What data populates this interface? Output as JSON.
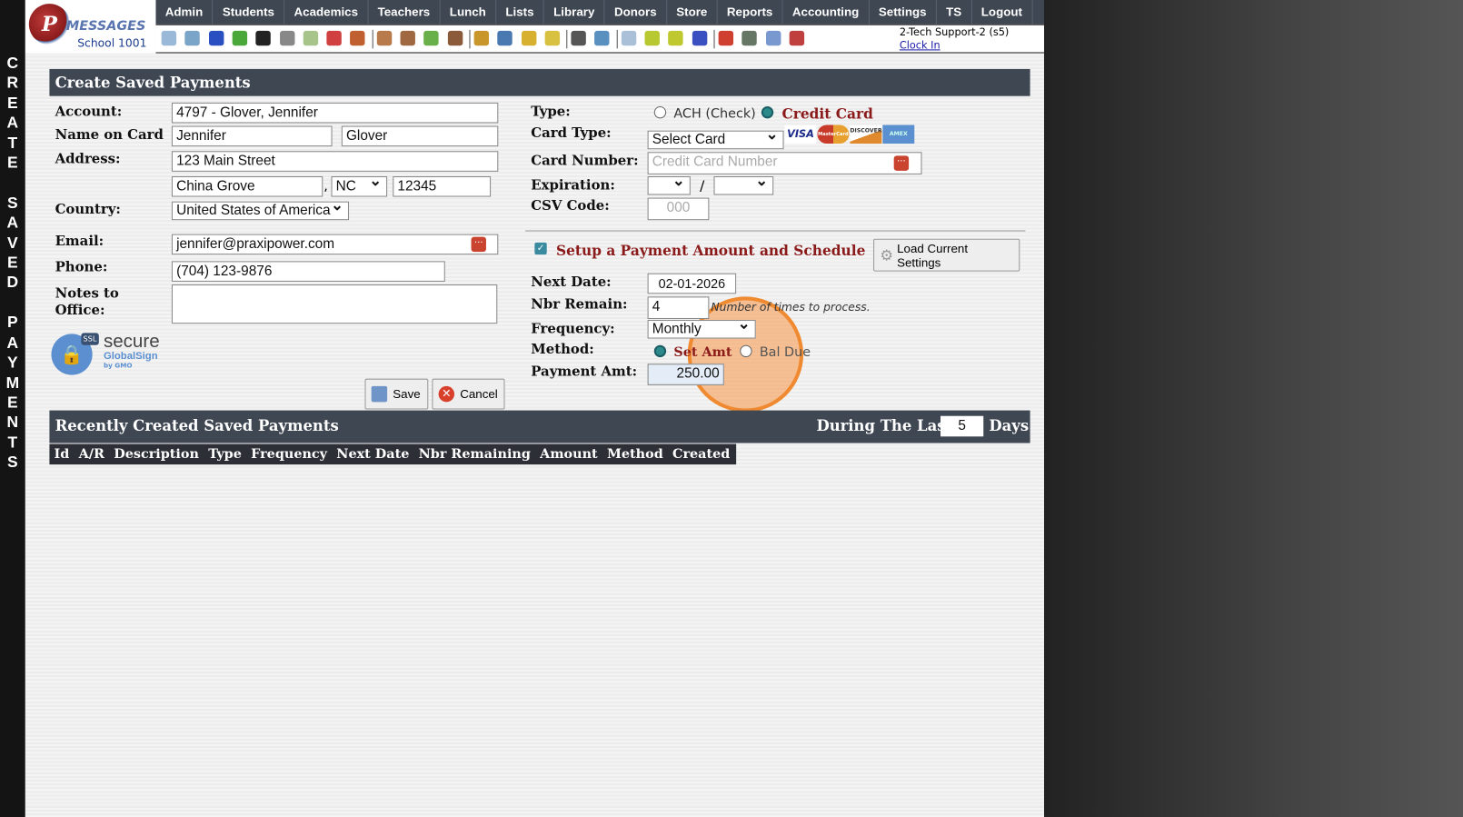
{
  "side_title": "CREATE SAVED PAYMENTS",
  "logo": {
    "brand": "MESSAGES",
    "school": "School 1001"
  },
  "nav": [
    "Admin",
    "Students",
    "Academics",
    "Teachers",
    "Lunch",
    "Lists",
    "Library",
    "Donors",
    "Store",
    "Reports",
    "Accounting",
    "Settings",
    "TS",
    "Logout"
  ],
  "toolbar_icons": [
    {
      "name": "search-icon",
      "color": "#9ab8d8"
    },
    {
      "name": "calendar-grid-icon",
      "color": "#7aa4c8"
    },
    {
      "name": "at-icon",
      "color": "#2a4fc0"
    },
    {
      "name": "chat-icon",
      "color": "#4aa83a"
    },
    {
      "name": "phone-icon",
      "color": "#222222"
    },
    {
      "name": "speaker-icon",
      "color": "#888888"
    },
    {
      "name": "calendar-chart-icon",
      "color": "#a7c48a"
    },
    {
      "name": "calendar-icon",
      "color": "#d04040"
    },
    {
      "name": "megaphone-icon",
      "color": "#c06030"
    },
    {
      "name": "add-user-icon",
      "color": "#b87a4a"
    },
    {
      "name": "user-icon",
      "color": "#a06840"
    },
    {
      "name": "money-icon",
      "color": "#6ab04a"
    },
    {
      "name": "users-icon",
      "color": "#8a5a3a"
    },
    {
      "name": "burger-icon",
      "color": "#c8962a"
    },
    {
      "name": "book-icon",
      "color": "#4a78b0"
    },
    {
      "name": "bell-icon",
      "color": "#d8b030"
    },
    {
      "name": "note-arrow-icon",
      "color": "#d8c040"
    },
    {
      "name": "person-icon",
      "color": "#555555"
    },
    {
      "name": "alarm-clock-icon",
      "color": "#5a90c0"
    },
    {
      "name": "list-icon",
      "color": "#aac0d8"
    },
    {
      "name": "card-icon",
      "color": "#b8c830"
    },
    {
      "name": "printer-icon",
      "color": "#c0c830"
    },
    {
      "name": "ap-icon",
      "color": "#3a50c0"
    },
    {
      "name": "pdf-icon",
      "color": "#d04030"
    },
    {
      "name": "cash-register-icon",
      "color": "#667766"
    },
    {
      "name": "help-icon",
      "color": "#7a98d0"
    },
    {
      "name": "power-icon",
      "color": "#c04040"
    }
  ],
  "user": {
    "name": "2-Tech Support-2 (s5)",
    "clock_in": "Clock In"
  },
  "form": {
    "title": "Create Saved Payments",
    "account_label": "Account:",
    "account": "4797 - Glover, Jennifer",
    "name_label": "Name on Card",
    "first_name": "Jennifer",
    "last_name": "Glover",
    "address_label": "Address:",
    "street": "123 Main Street",
    "city": "China Grove",
    "state": "NC",
    "zip": "12345",
    "country_label": "Country:",
    "country": "United States of America",
    "email_label": "Email:",
    "email": "jennifer@praxipower.com",
    "phone_label": "Phone:",
    "phone": "(704) 123-9876",
    "notes_label": "Notes to Office:",
    "notes": "",
    "ssl": {
      "text": "secure",
      "brand": "GlobalSign",
      "sub": "by GMO",
      "badge": "SSL"
    },
    "save": "Save",
    "cancel": "Cancel",
    "type_label": "Type:",
    "type_ach": "ACH (Check)",
    "type_cc": "Credit Card",
    "type_selected": "Credit Card",
    "card_type_label": "Card Type:",
    "card_type": "Select Card",
    "card_logos": [
      "VISA",
      "MasterCard",
      "DISCOVER",
      "AMEX"
    ],
    "card_number_label": "Card Number:",
    "card_number_placeholder": "Credit Card Number",
    "expiration_label": "Expiration:",
    "exp_sep": "/",
    "csv_label": "CSV Code:",
    "csv_placeholder": "000",
    "schedule_checked": true,
    "schedule_label": "Setup a Payment Amount and Schedule",
    "load_settings": "Load Current Settings",
    "next_date_label": "Next Date:",
    "next_date": "02-01-2026",
    "nbr_remain_label": "Nbr Remain:",
    "nbr_remain": "4",
    "nbr_hint": "Number of times to process.",
    "frequency_label": "Frequency:",
    "frequency": "Monthly",
    "method_label": "Method:",
    "method_set": "Set Amt",
    "method_bal": "Bal Due",
    "method_selected": "Set Amt",
    "payment_amt_label": "Payment Amt:",
    "payment_amt": "250.00"
  },
  "recent": {
    "title": "Recently Created Saved Payments",
    "during": "During The Last",
    "days_value": "5",
    "days": "Days",
    "columns": [
      "Id",
      "A/R",
      "Description",
      "Type",
      "Frequency",
      "Next Date",
      "Nbr Remaining",
      "Amount",
      "Method",
      "Created"
    ]
  }
}
